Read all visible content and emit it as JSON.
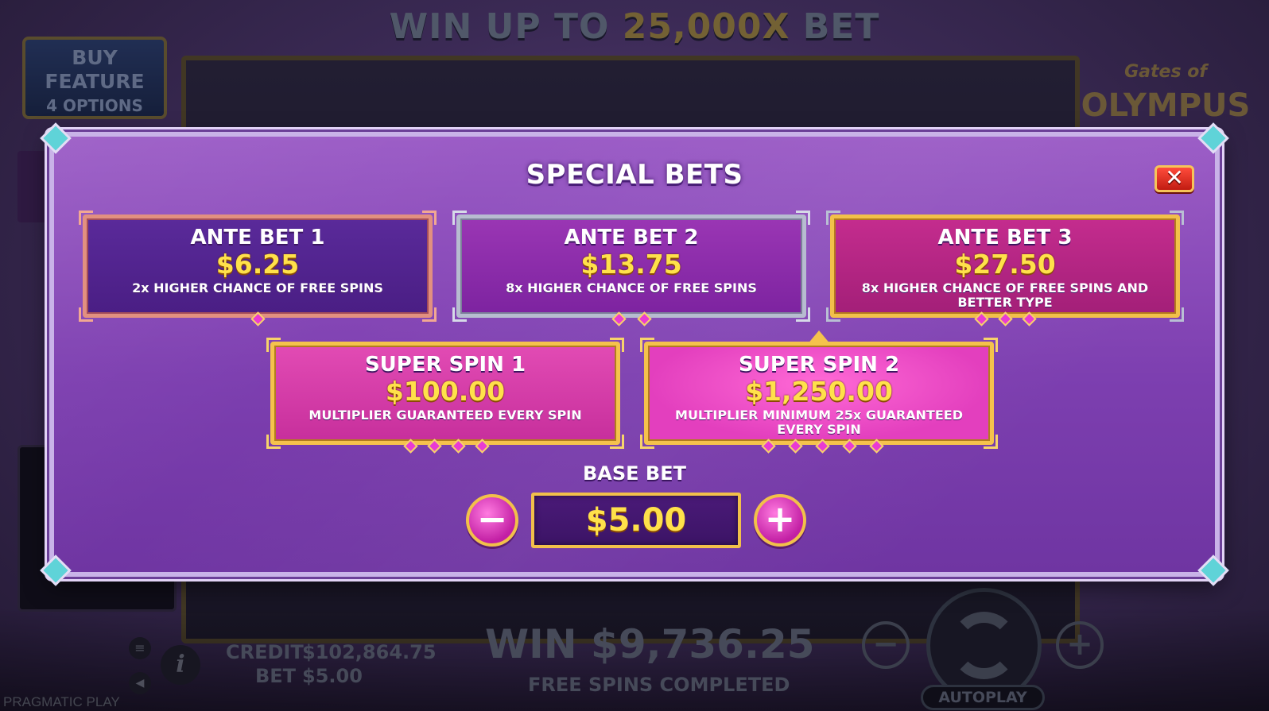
{
  "background": {
    "banner_prefix": "WIN UP TO",
    "banner_highlight": "25,000X",
    "banner_suffix": "BET",
    "buy_feature_line1": "BUY",
    "buy_feature_line2": "FEATURE",
    "buy_feature_line3": "4 OPTIONS",
    "logo_small": "Gates of",
    "logo_big": "OLYMPUS",
    "credit_label": "CREDIT",
    "credit_value": "$102,864.75",
    "bet_label": "BET",
    "bet_value": "$5.00",
    "win_label": "WIN",
    "win_value": "$9,736.25",
    "status_text": "FREE SPINS COMPLETED",
    "autoplay_label": "AUTOPLAY",
    "brand": "PRAGMATIC PLAY"
  },
  "modal": {
    "title": "SPECIAL BETS",
    "close_symbol": "✕",
    "options": [
      {
        "title": "ANTE BET 1",
        "price": "$6.25",
        "description": "2x HIGHER CHANCE OF FREE SPINS"
      },
      {
        "title": "ANTE BET 2",
        "price": "$13.75",
        "description": "8x HIGHER CHANCE OF FREE SPINS"
      },
      {
        "title": "ANTE BET 3",
        "price": "$27.50",
        "description": "8x HIGHER CHANCE OF FREE SPINS AND BETTER TYPE"
      },
      {
        "title": "SUPER SPIN 1",
        "price": "$100.00",
        "description": "MULTIPLIER GUARANTEED EVERY SPIN"
      },
      {
        "title": "SUPER SPIN 2",
        "price": "$1,250.00",
        "description": "MULTIPLIER MINIMUM 25x GUARANTEED EVERY SPIN"
      }
    ],
    "base_bet_label": "BASE BET",
    "base_bet_value": "$5.00",
    "minus_symbol": "−",
    "plus_symbol": "+"
  },
  "colors": {
    "accent_gold": "#f2c04a",
    "price_yellow": "#ffe14a",
    "modal_purple": "#7d3fb0",
    "close_red": "#e0281c"
  },
  "icons": [
    "close-icon",
    "minus-icon",
    "plus-icon",
    "info-icon",
    "menu-icon",
    "sound-icon",
    "spin-icon"
  ]
}
